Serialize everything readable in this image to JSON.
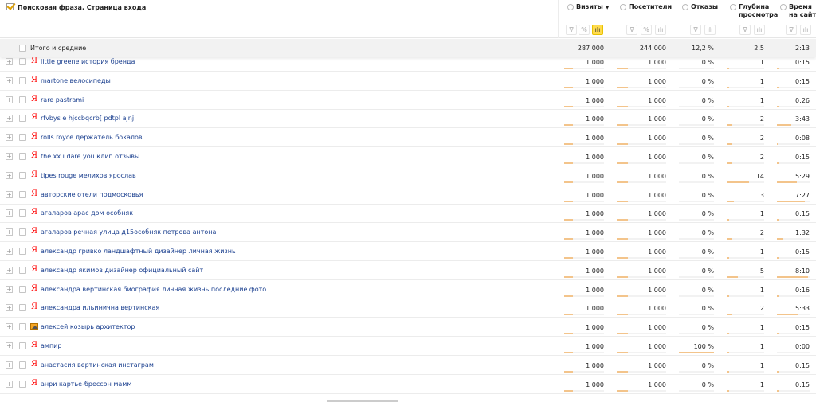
{
  "header": {
    "title": "Поисковая фраза, Страница входа",
    "metrics": [
      {
        "key": "vis",
        "label": "Визиты",
        "sort": "▼"
      },
      {
        "key": "pos",
        "label": "Посетители"
      },
      {
        "key": "otk",
        "label": "Отказы"
      },
      {
        "key": "glu",
        "label": "Глубина просмотра",
        "line1": "Глубина",
        "line2": "просмотра"
      },
      {
        "key": "vre",
        "label": "Время на сайте",
        "line1": "Время",
        "line2": "на сайте"
      }
    ],
    "tool_icons": {
      "filter": "filter-icon",
      "percent": "percent-icon",
      "chart": "bar-chart-icon"
    },
    "tool_glyphs": {
      "filter": "∇",
      "percent": "%",
      "chart": "ılı"
    }
  },
  "totals": {
    "label": "Итого и средние",
    "values": {
      "vis": "287 000",
      "pos": "244 000",
      "otk": "12,2 %",
      "glu": "2,5",
      "vre": "2:13"
    }
  },
  "rows": [
    {
      "phrase": "little greene история бренда",
      "icon": "yandex",
      "vis": "1 000",
      "pos": "1 000",
      "otk": "0 %",
      "glu": "1",
      "vre": "0:15",
      "glu_level": 0.07,
      "vre_level": 0.05
    },
    {
      "phrase": "martone велосипеды",
      "icon": "yandex",
      "vis": "1 000",
      "pos": "1 000",
      "otk": "0 %",
      "glu": "1",
      "vre": "0:15",
      "glu_level": 0.07,
      "vre_level": 0.05
    },
    {
      "phrase": "rare pastrami",
      "icon": "yandex",
      "vis": "1 000",
      "pos": "1 000",
      "otk": "0 %",
      "glu": "1",
      "vre": "0:26",
      "glu_level": 0.07,
      "vre_level": 0.06
    },
    {
      "phrase": "rfvbys e hjccbqcrb[ pdtpl ajnj",
      "icon": "yandex",
      "vis": "1 000",
      "pos": "1 000",
      "otk": "0 %",
      "glu": "2",
      "vre": "3:43",
      "glu_level": 0.14,
      "vre_level": 0.45
    },
    {
      "phrase": "rolls royce держатель бокалов",
      "icon": "yandex",
      "vis": "1 000",
      "pos": "1 000",
      "otk": "0 %",
      "glu": "2",
      "vre": "0:08",
      "glu_level": 0.14,
      "vre_level": 0.03
    },
    {
      "phrase": "the xx i dare you клип отзывы",
      "icon": "yandex",
      "vis": "1 000",
      "pos": "1 000",
      "otk": "0 %",
      "glu": "2",
      "vre": "0:15",
      "glu_level": 0.14,
      "vre_level": 0.05
    },
    {
      "phrase": "tipes rouge мелихов ярослав",
      "icon": "yandex",
      "vis": "1 000",
      "pos": "1 000",
      "otk": "0 %",
      "glu": "14",
      "vre": "5:29",
      "glu_level": 0.6,
      "vre_level": 0.6
    },
    {
      "phrase": "авторские отели подмосковья",
      "icon": "yandex",
      "vis": "1 000",
      "pos": "1 000",
      "otk": "0 %",
      "glu": "3",
      "vre": "7:27",
      "glu_level": 0.2,
      "vre_level": 0.85
    },
    {
      "phrase": "агаларов арас дом особняк",
      "icon": "yandex",
      "vis": "1 000",
      "pos": "1 000",
      "otk": "0 %",
      "glu": "1",
      "vre": "0:15",
      "glu_level": 0.07,
      "vre_level": 0.05
    },
    {
      "phrase": "агаларов речная улица д15особняк петрова антона",
      "icon": "yandex",
      "vis": "1 000",
      "pos": "1 000",
      "otk": "0 %",
      "glu": "2",
      "vre": "1:32",
      "glu_level": 0.14,
      "vre_level": 0.2
    },
    {
      "phrase": "александр гривко ландшафтный дизайнер личная жизнь",
      "icon": "yandex",
      "vis": "1 000",
      "pos": "1 000",
      "otk": "0 %",
      "glu": "1",
      "vre": "0:15",
      "glu_level": 0.07,
      "vre_level": 0.05
    },
    {
      "phrase": "александр якимов дизайнер официальный сайт",
      "icon": "yandex",
      "vis": "1 000",
      "pos": "1 000",
      "otk": "0 %",
      "glu": "5",
      "vre": "8:10",
      "glu_level": 0.3,
      "vre_level": 0.95
    },
    {
      "phrase": "александра вертинская биография личная жизнь последние фото",
      "icon": "yandex",
      "vis": "1 000",
      "pos": "1 000",
      "otk": "0 %",
      "glu": "1",
      "vre": "0:16",
      "glu_level": 0.07,
      "vre_level": 0.05
    },
    {
      "phrase": "александра ильинична вертинская",
      "icon": "yandex",
      "vis": "1 000",
      "pos": "1 000",
      "otk": "0 %",
      "glu": "2",
      "vre": "5:33",
      "glu_level": 0.14,
      "vre_level": 0.65
    },
    {
      "phrase": "алексей козырь архитектор",
      "icon": "image",
      "vis": "1 000",
      "pos": "1 000",
      "otk": "0 %",
      "glu": "1",
      "vre": "0:15",
      "glu_level": 0.07,
      "vre_level": 0.05
    },
    {
      "phrase": "ампир",
      "icon": "yandex",
      "vis": "1 000",
      "pos": "1 000",
      "otk": "100 %",
      "glu": "1",
      "vre": "0:00",
      "glu_level": 0.07,
      "vre_level": 0.0,
      "otk_level": 1.0
    },
    {
      "phrase": "анастасия вертинская инстаграм",
      "icon": "yandex",
      "vis": "1 000",
      "pos": "1 000",
      "otk": "0 %",
      "glu": "1",
      "vre": "0:15",
      "glu_level": 0.07,
      "vre_level": 0.05
    },
    {
      "phrase": "анри картье-брессон мамм",
      "icon": "yandex",
      "vis": "1 000",
      "pos": "1 000",
      "otk": "0 %",
      "glu": "1",
      "vre": "0:15",
      "glu_level": 0.07,
      "vre_level": 0.05
    }
  ],
  "yandex_glyph": "Я",
  "plus_glyph": "+",
  "colors": {
    "link": "#1a3f8f",
    "bar": "#f3c48b",
    "accent": "#ffdb4d",
    "yandex": "#ff0000"
  }
}
